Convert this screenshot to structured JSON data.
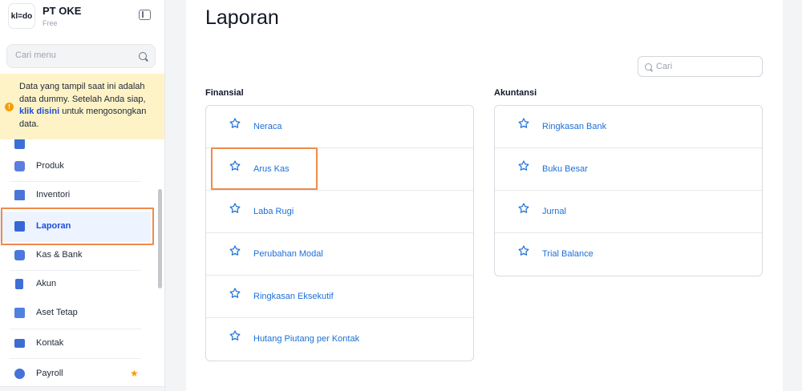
{
  "sidebar": {
    "logo_text": "kl=do",
    "company": "PT OKE",
    "plan": "Free",
    "search_placeholder": "Cari menu",
    "alert": {
      "text_before": "Data yang tampil saat ini adalah data dummy. Setelah Anda siap, ",
      "link": "klik disini",
      "text_after": " untuk mengosongkan data."
    },
    "items": [
      {
        "label": "Produk",
        "icon": "cube-icon"
      },
      {
        "label": "Inventori",
        "icon": "warehouse-icon"
      },
      {
        "label": "Laporan",
        "icon": "chart-icon",
        "active": true
      },
      {
        "label": "Kas & Bank",
        "icon": "wallet-icon"
      },
      {
        "label": "Akun",
        "icon": "book-icon"
      },
      {
        "label": "Aset Tetap",
        "icon": "building-icon"
      },
      {
        "label": "Kontak",
        "icon": "contact-card-icon"
      },
      {
        "label": "Payroll",
        "icon": "payroll-icon"
      }
    ]
  },
  "main": {
    "title": "Laporan",
    "search_placeholder": "Cari",
    "finansial": {
      "title": "Finansial",
      "reports": [
        "Neraca",
        "Arus Kas",
        "Laba Rugi",
        "Perubahan Modal",
        "Ringkasan Eksekutif",
        "Hutang Piutang per Kontak"
      ]
    },
    "akuntansi": {
      "title": "Akuntansi",
      "reports": [
        "Ringkasan Bank",
        "Buku Besar",
        "Jurnal",
        "Trial Balance"
      ]
    }
  },
  "colors": {
    "accent": "#1d6fd8",
    "highlight": "#ef8a4a",
    "alert_bg": "#fef3c7"
  }
}
